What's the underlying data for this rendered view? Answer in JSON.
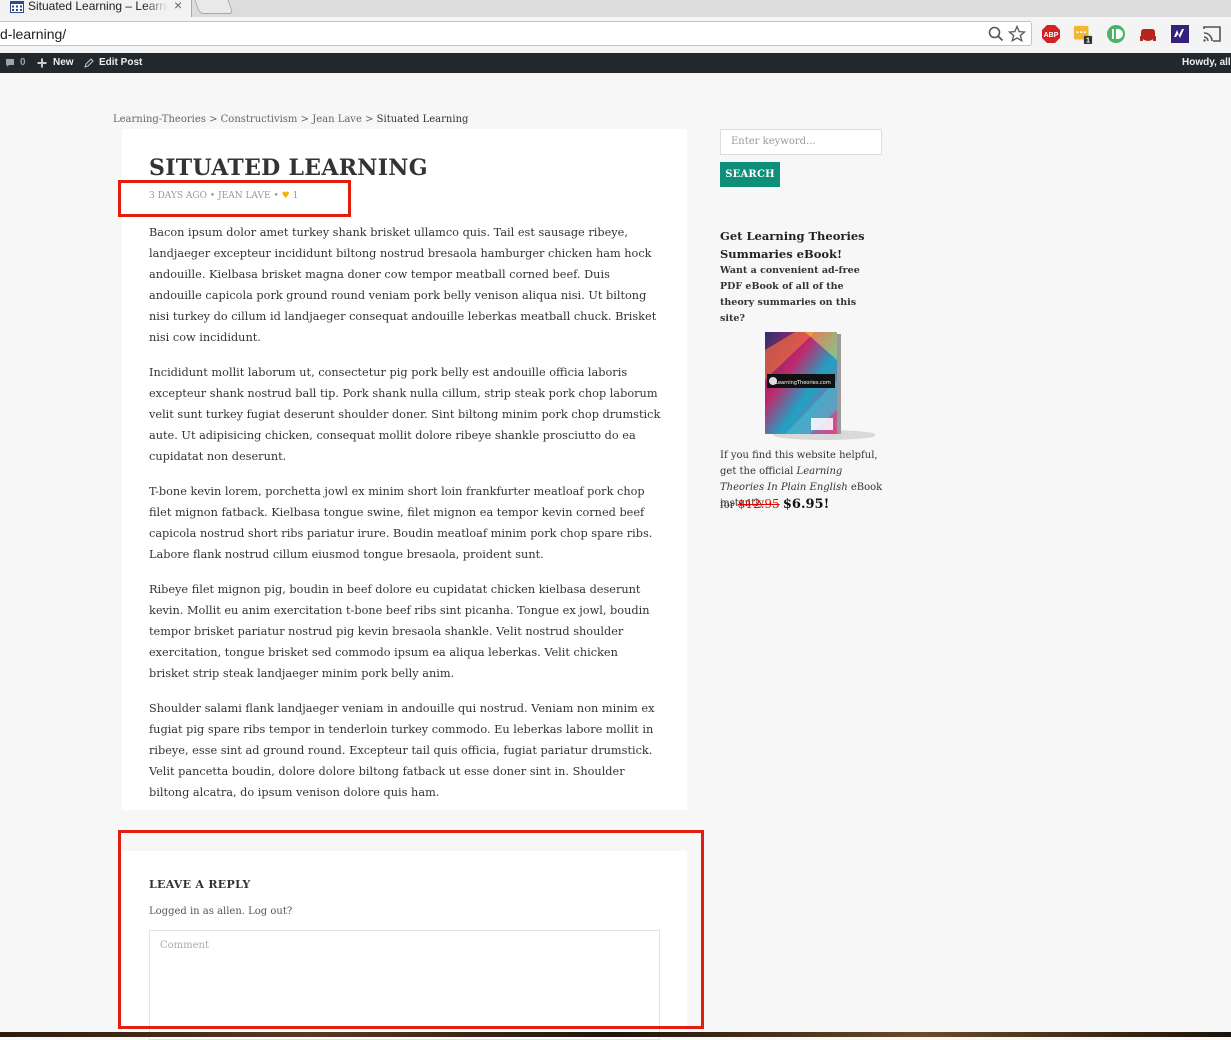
{
  "browser": {
    "tab_title": "Situated Learning – Learning Theories",
    "tab_close": "×",
    "url": "d-learning/"
  },
  "admin_bar": {
    "comments_count": "0",
    "new_label": "New",
    "edit_label": "Edit Post",
    "howdy": "Howdy, allen"
  },
  "breadcrumb": {
    "items": [
      "Learning-Theories",
      "Constructivism",
      "Jean Lave"
    ],
    "separator": ">",
    "current": "Situated Learning"
  },
  "post": {
    "title": "SITUATED LEARNING",
    "meta_date": "3 DAYS AGO",
    "meta_author": "JEAN LAVE",
    "meta_dot": "•",
    "likes": "1",
    "paragraphs": [
      "Bacon ipsum dolor amet turkey shank brisket ullamco quis. Tail est sausage ribeye, landjaeger excepteur incididunt biltong nostrud bresaola hamburger chicken ham hock andouille. Kielbasa brisket magna doner cow tempor meatball corned beef. Duis andouille capicola pork ground round veniam pork belly venison aliqua nisi. Ut biltong nisi turkey do cillum id landjaeger consequat andouille leberkas meatball chuck. Brisket nisi cow incididunt.",
      "Incididunt mollit laborum ut, consectetur pig pork belly est andouille officia laboris excepteur shank nostrud ball tip. Pork shank nulla cillum, strip steak pork chop laborum velit sunt turkey fugiat deserunt shoulder doner. Sint biltong minim pork chop drumstick aute. Ut adipisicing chicken, consequat mollit dolore ribeye shankle prosciutto do ea cupidatat non deserunt.",
      "T-bone kevin lorem, porchetta jowl ex minim short loin frankfurter meatloaf pork chop filet mignon fatback. Kielbasa tongue swine, filet mignon ea tempor kevin corned beef capicola nostrud short ribs pariatur irure. Boudin meatloaf minim pork chop spare ribs. Labore flank nostrud cillum eiusmod tongue bresaola, proident sunt.",
      "Ribeye filet mignon pig, boudin in beef dolore eu cupidatat chicken kielbasa deserunt kevin. Mollit eu anim exercitation t-bone beef ribs sint picanha. Tongue ex jowl, boudin tempor brisket pariatur nostrud pig kevin bresaola shankle. Velit nostrud shoulder exercitation, tongue brisket sed commodo ipsum ea aliqua leberkas. Velit chicken brisket strip steak landjaeger minim pork belly anim.",
      "Shoulder salami flank landjaeger veniam in andouille qui nostrud. Veniam non minim ex fugiat pig spare ribs tempor in tenderloin turkey commodo. Eu leberkas labore mollit in ribeye, esse sint ad ground round. Excepteur tail quis officia, fugiat pariatur drumstick. Velit pancetta boudin, dolore dolore biltong fatback ut esse doner sint in. Shoulder biltong alcatra, do ipsum venison dolore quis ham."
    ]
  },
  "reply": {
    "title": "LEAVE A REPLY",
    "logged_in": "Logged in as allen. Log out?",
    "comment_placeholder": "Comment"
  },
  "sidebar": {
    "search_placeholder": "Enter keyword...",
    "search_button": "SEARCH",
    "promo_heading": "Get Learning Theories Summaries eBook!",
    "promo_sub": "Want a convenient ad-free PDF eBook of all of the theory summaries on this site?",
    "promo_text_1": "If you find this website helpful, get the official ",
    "promo_text_italic": "Learning Theories In Plain English",
    "promo_text_2": " eBook instantly",
    "price_prefix": "for",
    "old_price": "$12.95",
    "new_price": "$6.95!",
    "ebook_label": "LearningTheories.com"
  },
  "colors": {
    "accent": "#0d8f7a",
    "admin_bar": "#23282d",
    "annotation_red": "#e41e0e",
    "heart": "#f0b400"
  },
  "icons": [
    "calendar-grid-icon",
    "close-icon",
    "zoom-icon",
    "bookmark-star-icon",
    "adblock-plus-icon",
    "extension-badge-icon",
    "pushbullet-icon",
    "pocket-icon",
    "vimeo-icon",
    "cast-icon",
    "comment-bubble-icon",
    "plus-icon",
    "pencil-icon",
    "heart-icon"
  ]
}
